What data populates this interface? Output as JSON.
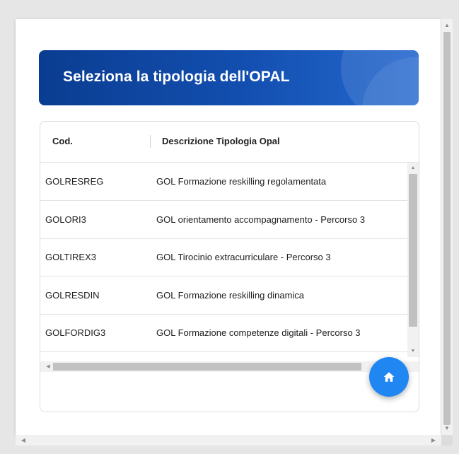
{
  "dialog": {
    "title": "Seleziona la tipologia dell'OPAL"
  },
  "table": {
    "columns": [
      "Cod.",
      "Descrizione Tipologia Opal"
    ],
    "rows": [
      {
        "code": "GOLRESREG",
        "description": "GOL Formazione reskilling regolamentata"
      },
      {
        "code": "GOLORI3",
        "description": "GOL orientamento accompagnamento - Percorso 3"
      },
      {
        "code": "GOLTIREX3",
        "description": "GOL Tirocinio extracurriculare - Percorso 3"
      },
      {
        "code": "GOLRESDIN",
        "description": "GOL Formazione reskilling dinamica"
      },
      {
        "code": "GOLFORDIG3",
        "description": "GOL Formazione competenze digitali - Percorso 3"
      }
    ]
  },
  "fab": {
    "icon": "home-icon",
    "color": "#1f86f2"
  },
  "colors": {
    "header_start": "#0a3d91",
    "header_end": "#2569cf"
  }
}
